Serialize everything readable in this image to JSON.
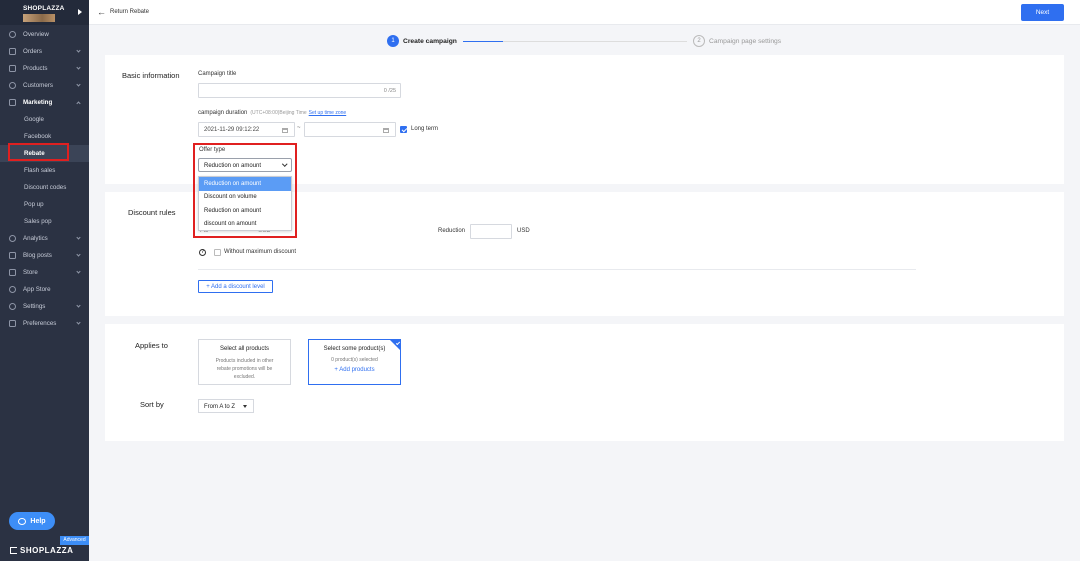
{
  "sidebar": {
    "brand": "SHOPLAZZA",
    "items": [
      {
        "label": "Overview"
      },
      {
        "label": "Orders"
      },
      {
        "label": "Products"
      },
      {
        "label": "Customers"
      },
      {
        "label": "Marketing"
      },
      {
        "label": "Analytics"
      },
      {
        "label": "Blog posts"
      },
      {
        "label": "Store"
      },
      {
        "label": "App Store"
      },
      {
        "label": "Settings"
      },
      {
        "label": "Preferences"
      }
    ],
    "marketing_sub": [
      "Google",
      "Facebook",
      "Rebate",
      "Flash sales",
      "Discount codes",
      "Pop up",
      "Sales pop"
    ],
    "help_label": "Help",
    "advanced_label": "Advanced",
    "footer_brand": "SHOPLAZZA"
  },
  "topbar": {
    "back_label": "Return Rebate",
    "next_label": "Next"
  },
  "steps": [
    {
      "num": "1",
      "label": "Create campaign"
    },
    {
      "num": "2",
      "label": "Campaign page settings"
    }
  ],
  "basic": {
    "section_label": "Basic information",
    "title_label": "Campaign title",
    "title_counter": "0 /25",
    "duration_label": "campaign duration",
    "tz_note": "(UTC+08:00)Beijing Time",
    "tz_link": "Set up time zone",
    "start_date": "2021-11-29 09:12:22",
    "dash": "~",
    "long_term_label": "Long term",
    "offer_label": "Offer type",
    "offer_selected": "Reduction on amount",
    "offer_options": [
      "Reduction on amount",
      "Discount on volume",
      "Reduction on amount",
      "discount on amount"
    ]
  },
  "discount": {
    "section_label": "Discount rules",
    "reduction_label": "Reduction",
    "currency": "USD",
    "partial_left": "Ful",
    "partial_mid": "USD",
    "without_max_label": "Without maximum discount",
    "add_level_label": "+ Add a discount level",
    "help_glyph": "?"
  },
  "applies": {
    "section_label": "Applies to",
    "all_title": "Select all products",
    "all_desc": "Products included in other rebate promotions will be excluded.",
    "some_title": "Select some product(s)",
    "some_count": "0 product(s) selected",
    "some_add": "+ Add products",
    "sort_label": "Sort by",
    "sort_value": "From A to Z"
  },
  "colors": {
    "accent": "#2f6ff0",
    "sidebar_bg": "#2b3243",
    "highlight": "#e02020"
  }
}
